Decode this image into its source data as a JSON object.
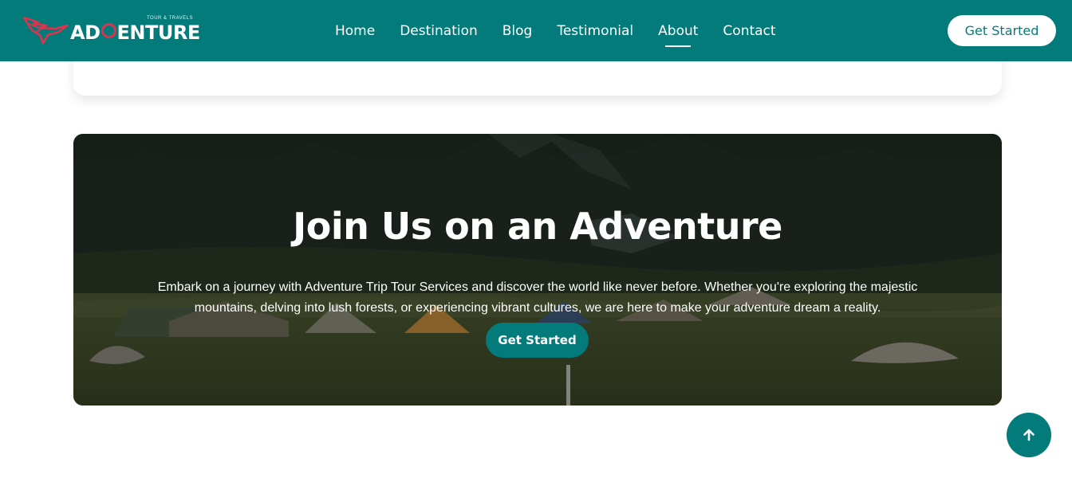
{
  "header": {
    "logo_text_a": "AD",
    "logo_text_b": "ENTURE",
    "logo_tagline": "TOUR & TRAVELS",
    "nav": [
      {
        "label": "Home"
      },
      {
        "label": "Destination"
      },
      {
        "label": "Blog"
      },
      {
        "label": "Testimonial"
      },
      {
        "label": "About",
        "active": true
      },
      {
        "label": "Contact"
      }
    ],
    "cta_label": "Get Started"
  },
  "hero": {
    "title": "Join Us on an Adventure",
    "text": "Embark on a journey with Adventure Trip Tour Services and discover the world like never before. Whether you're exploring the majestic mountains, delving into lush forests, or experiencing vibrant cultures, we are here to make your adventure dream a reality.",
    "cta_label": "Get Started",
    "background_icon": "mountain-camp-photo"
  },
  "scroll_top": {
    "icon": "arrow-up-icon"
  },
  "colors": {
    "brand": "#037b7a",
    "accent": "#e0334b",
    "white": "#ffffff"
  }
}
